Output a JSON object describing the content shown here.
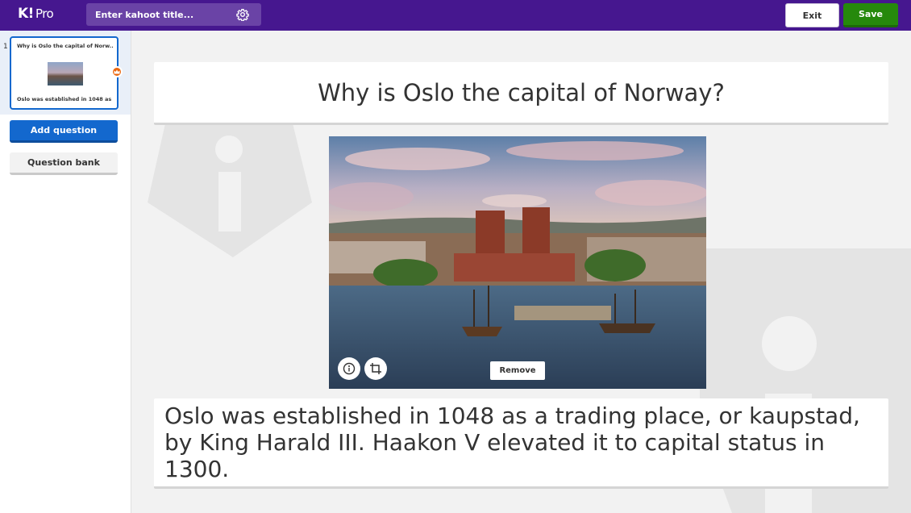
{
  "app": {
    "logo": "K!",
    "logo_suffix": "Pro"
  },
  "header": {
    "title_placeholder": "Enter kahoot title...",
    "exit_label": "Exit",
    "save_label": "Save"
  },
  "sidebar": {
    "slides": [
      {
        "number": "1",
        "title": "Why is Oslo the capital of Norw...",
        "answer": "Oslo was established in 1048 as ..."
      }
    ],
    "add_question_label": "Add question",
    "question_bank_label": "Question bank"
  },
  "editor": {
    "question": "Why is Oslo the capital of Norway?",
    "image_remove_label": "Remove",
    "answer": "Oslo was established in 1048 as a trading place, or kaupstad, by King Harald III. Haakon V elevated it to capital status in 1300."
  },
  "icons": {
    "settings": "gear-icon",
    "image_info": "info-icon",
    "image_crop": "crop-icon",
    "slide_badge": "crown-icon"
  },
  "colors": {
    "brand_purple": "#46178f",
    "save_green": "#26890c",
    "primary_blue": "#1368ce",
    "badge_orange": "#eb670f"
  }
}
